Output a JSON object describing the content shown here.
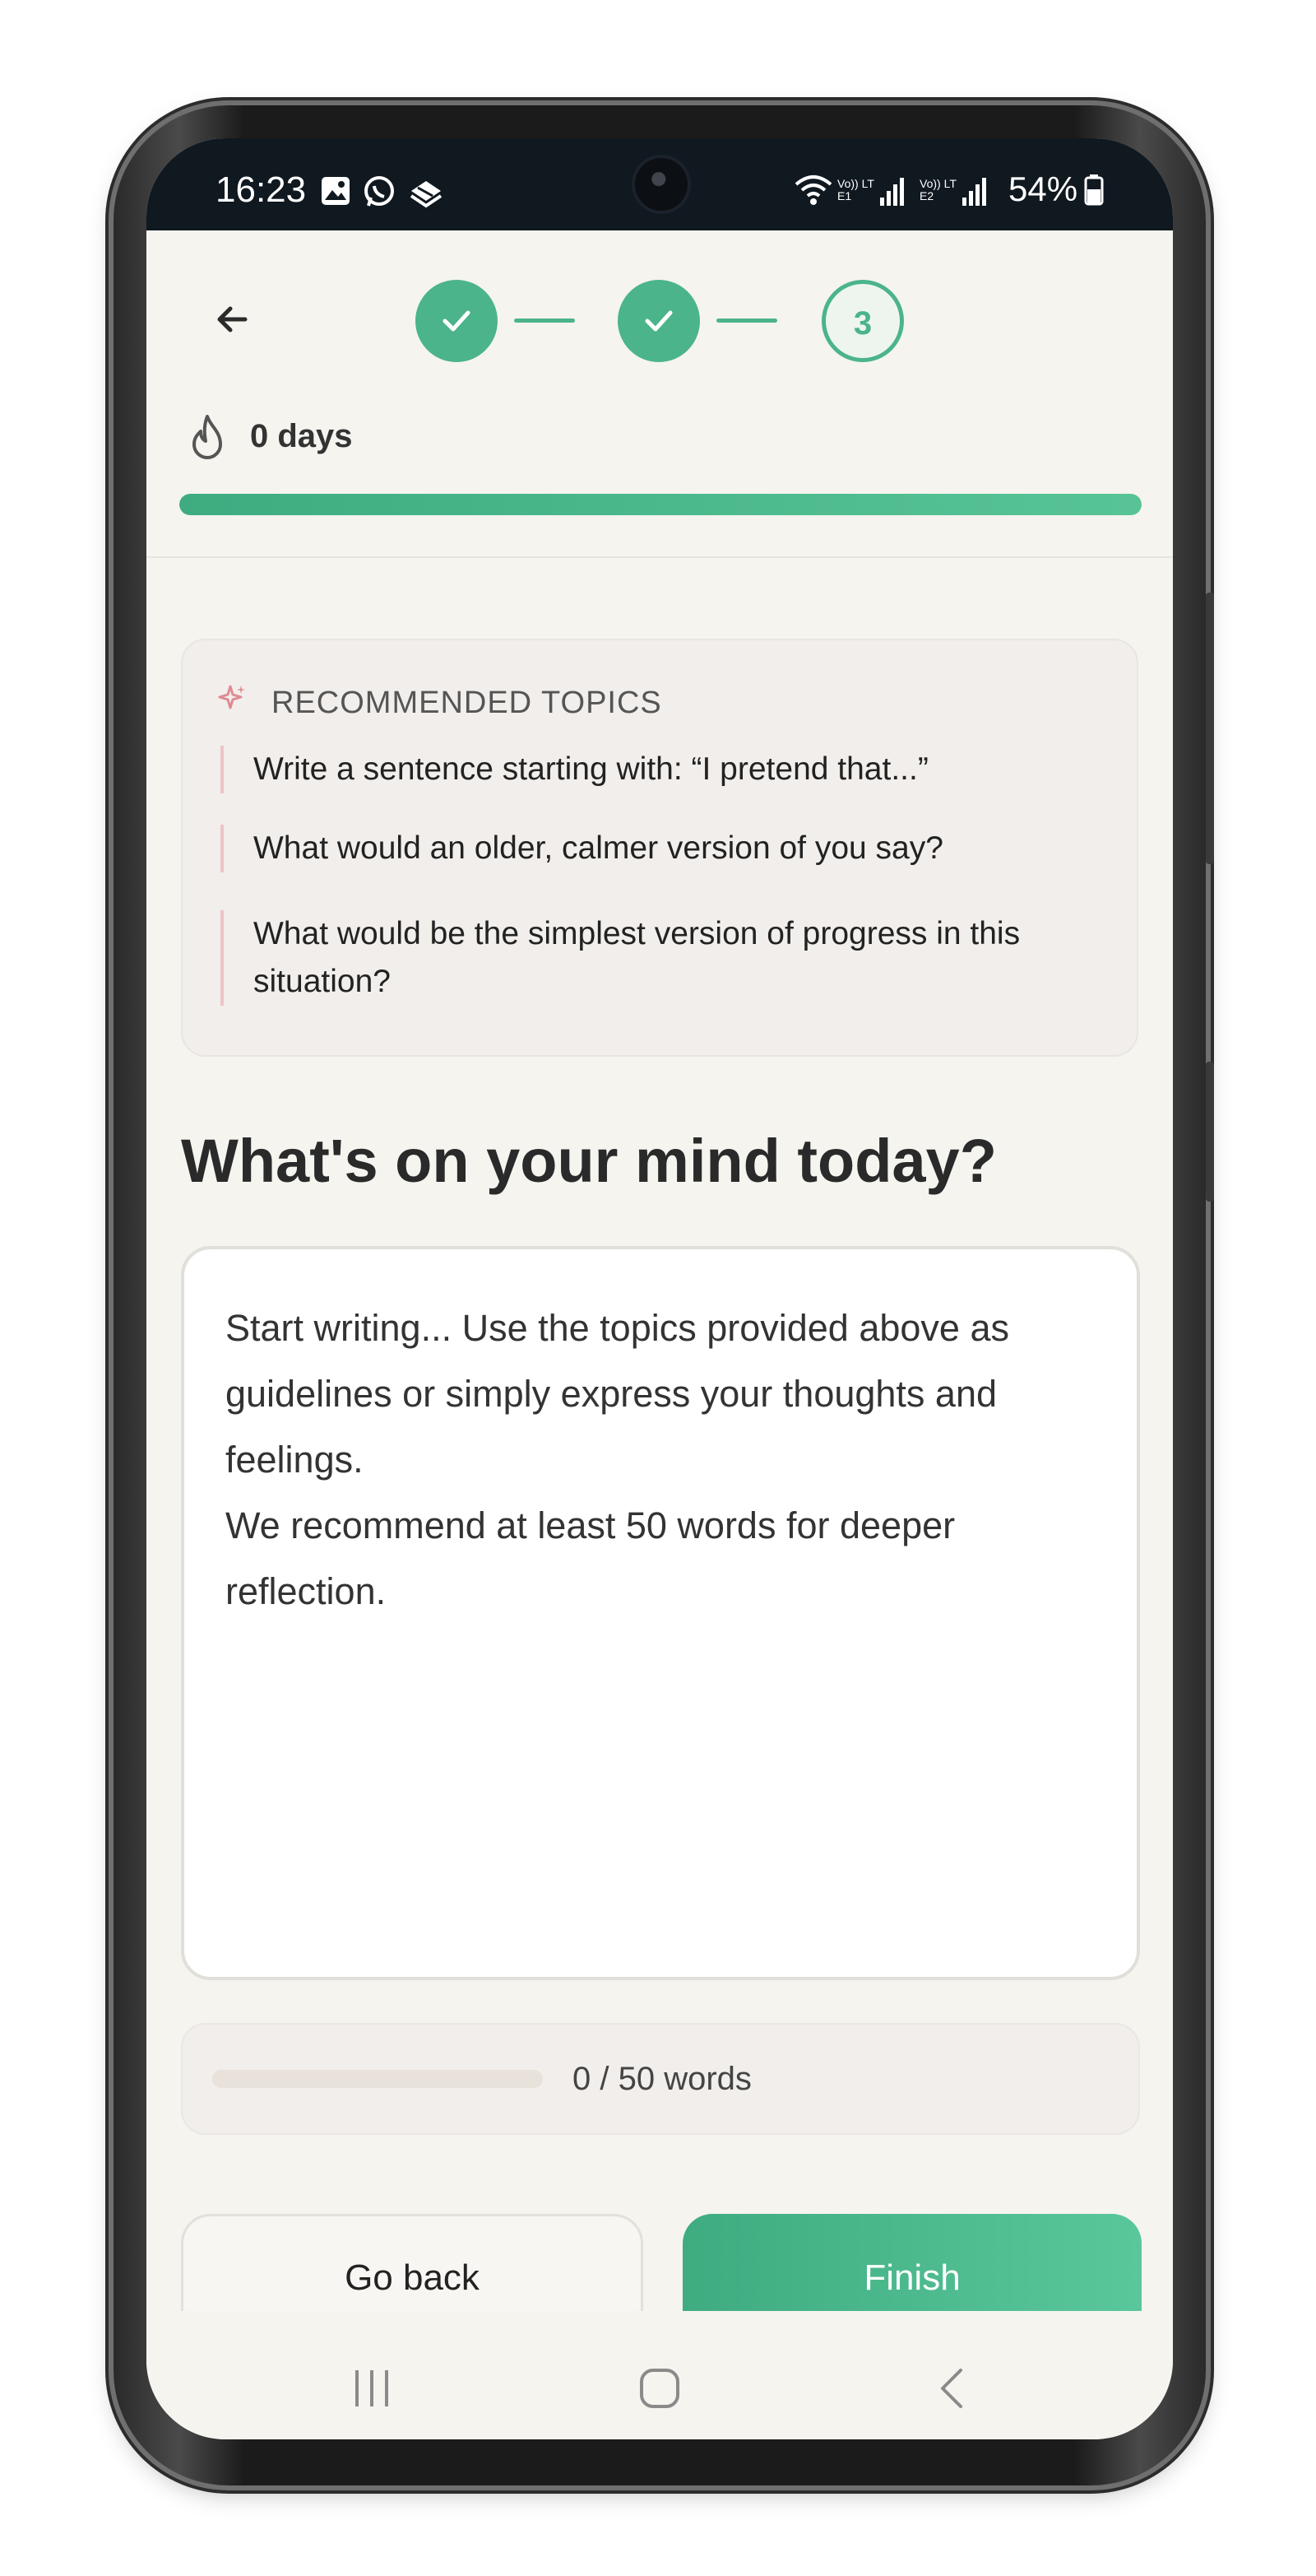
{
  "status_bar": {
    "time": "16:23",
    "network_labels": [
      "Vo)) LTE1",
      "Vo)) LTE2"
    ],
    "battery": "54%"
  },
  "header": {
    "steps": [
      {
        "state": "done"
      },
      {
        "state": "done"
      },
      {
        "state": "current",
        "label": "3"
      }
    ],
    "streak_text": "0 days",
    "streak_progress": 1.0,
    "accent_color": "#4bb48a"
  },
  "topics": {
    "title": "RECOMMENDED TOPICS",
    "items": [
      "Write a sentence starting with: “I pretend that...”",
      "What would an older, calmer version of you say?",
      "What would be the simplest version of progress in this situation?"
    ]
  },
  "prompt": {
    "heading": "What's on your mind today?",
    "placeholder": "Start writing... Use the topics provided above as guidelines or simply express your thoughts and feelings.\nWe recommend at least 50 words for deeper reflection."
  },
  "word_counter": {
    "text": "0 / 50 words",
    "progress": 0
  },
  "buttons": {
    "back_label": "Go back",
    "finish_label": "Finish"
  },
  "icons": {
    "back": "arrow-left-icon",
    "check": "check-icon",
    "streak": "flame-icon",
    "topics": "sparkle-icon",
    "nav": [
      "recent-apps-icon",
      "home-icon",
      "back-icon"
    ]
  }
}
